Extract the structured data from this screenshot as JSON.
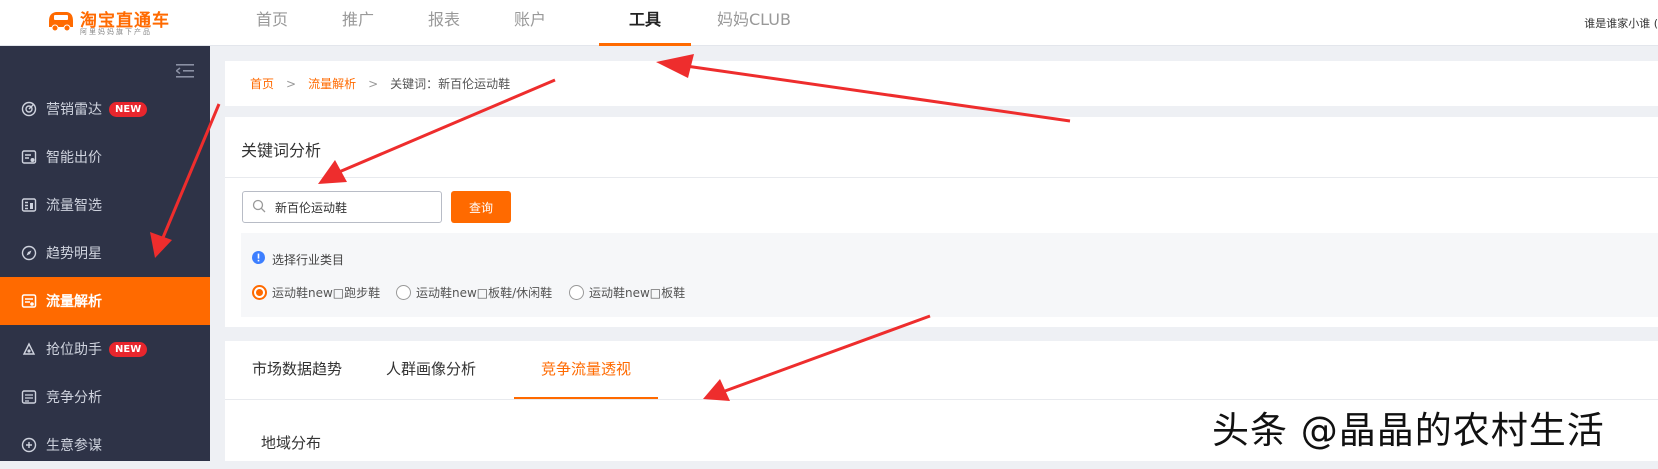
{
  "logo": {
    "title": "淘宝直通车",
    "subtitle": "阿里妈妈旗下产品",
    "icon": "car-logo-icon"
  },
  "topnav": {
    "items": [
      {
        "label": "首页"
      },
      {
        "label": "推广"
      },
      {
        "label": "报表"
      },
      {
        "label": "账户"
      },
      {
        "label": "工具",
        "active": true
      },
      {
        "label": "妈妈CLUB"
      }
    ],
    "user": "谁是谁家小谁 ("
  },
  "sidebar": {
    "collapse_icon": "collapse-menu-icon",
    "items": [
      {
        "label": "营销雷达",
        "icon": "radar-icon",
        "badge": "NEW"
      },
      {
        "label": "智能出价",
        "icon": "smart-bid-icon"
      },
      {
        "label": "流量智选",
        "icon": "traffic-select-icon"
      },
      {
        "label": "趋势明星",
        "icon": "compass-icon"
      },
      {
        "label": "流量解析",
        "icon": "traffic-analysis-icon",
        "active": true
      },
      {
        "label": "抢位助手",
        "icon": "position-helper-icon",
        "badge": "NEW"
      },
      {
        "label": "竞争分析",
        "icon": "competition-icon"
      },
      {
        "label": "生意参谋",
        "icon": "business-advisor-icon"
      }
    ]
  },
  "breadcrumb": {
    "home": "首页",
    "section": "流量解析",
    "current": "关键词：新百伦运动鞋",
    "separator": ">"
  },
  "keyword_panel": {
    "title": "关键词分析",
    "search_value": "新百伦运动鞋",
    "query_button": "查询",
    "category_label": "选择行业类目",
    "options": [
      {
        "label": "运动鞋new□跑步鞋",
        "checked": true
      },
      {
        "label": "运动鞋new□板鞋/休闲鞋",
        "checked": false
      },
      {
        "label": "运动鞋new□板鞋",
        "checked": false
      }
    ]
  },
  "tabs": {
    "items": [
      {
        "label": "市场数据趋势"
      },
      {
        "label": "人群画像分析"
      },
      {
        "label": "竞争流量透视",
        "active": true
      }
    ],
    "section_title": "地域分布"
  },
  "watermark": "头条 @晶晶的农村生活",
  "colors": {
    "accent": "#ff6a00",
    "sidebar_bg": "#2e3347",
    "badge_red": "#e8262d",
    "annotation_arrow": "#ee2d2d",
    "page_bg": "#eef0f4"
  }
}
